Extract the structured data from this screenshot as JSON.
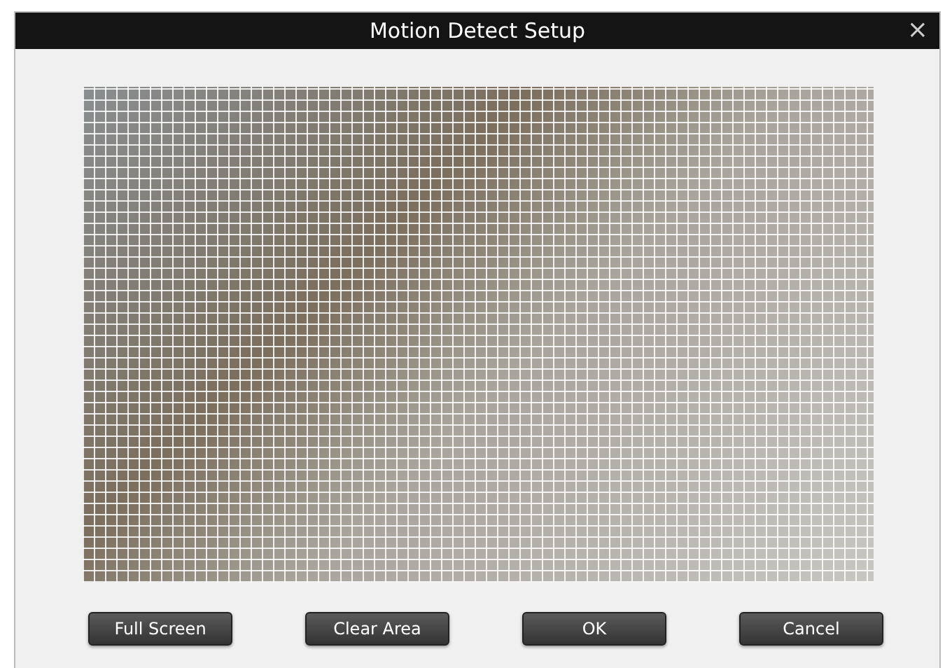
{
  "window": {
    "title": "Motion Detect Setup",
    "close_glyph": "×"
  },
  "buttons": [
    {
      "label": "Full Screen"
    },
    {
      "label": "Clear Area"
    },
    {
      "label": "OK"
    },
    {
      "label": "Cancel"
    }
  ]
}
